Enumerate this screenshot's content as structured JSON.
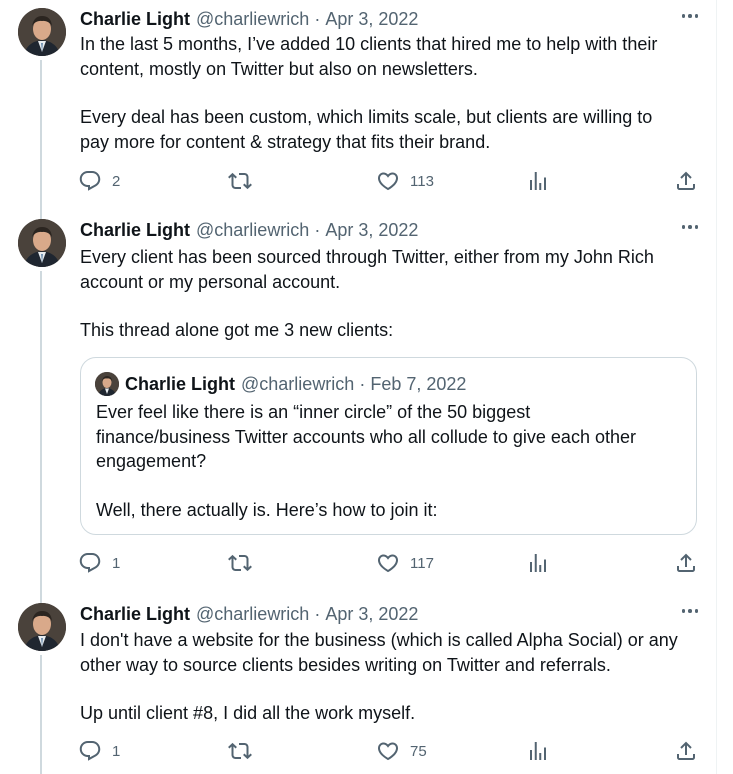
{
  "colors": {
    "text": "#0f1419",
    "secondary": "#536471",
    "line": "#cfd9de"
  },
  "tweets": [
    {
      "name": "Charlie Light",
      "handle": "@charliewrich",
      "dot": "·",
      "date": "Apr 3, 2022",
      "paragraphs": [
        "In the last 5 months, I’ve added 10 clients that hired me to help with their\ncontent, mostly on Twitter but also on newsletters.",
        "Every deal has been custom, which limits scale, but clients are willing to\npay more for content & strategy that fits their brand."
      ],
      "replies": "2",
      "retweets": "",
      "likes": "113"
    },
    {
      "name": "Charlie Light",
      "handle": "@charliewrich",
      "dot": "·",
      "date": "Apr 3, 2022",
      "paragraphs": [
        "Every client has been sourced through Twitter, either from my John Rich\naccount or my personal account.",
        "This thread alone got me 3 new clients:"
      ],
      "quote": {
        "name": "Charlie Light",
        "handle": "@charliewrich",
        "dot": "·",
        "date": "Feb 7, 2022",
        "paragraphs": [
          "Ever feel like there is an “inner circle” of the 50 biggest\nfinance/business Twitter accounts who all collude to give each other\nengagement?",
          "Well, there actually is. Here’s how to join it:"
        ]
      },
      "replies": "1",
      "retweets": "",
      "likes": "117"
    },
    {
      "name": "Charlie Light",
      "handle": "@charliewrich",
      "dot": "·",
      "date": "Apr 3, 2022",
      "paragraphs": [
        "I don't have a website for the business (which is called Alpha Social) or any\nother way to source clients besides writing on Twitter and referrals.",
        "Up until client #8, I did all the work myself."
      ],
      "replies": "1",
      "retweets": "",
      "likes": "75"
    }
  ],
  "icons": {
    "reply": "reply-icon",
    "retweet": "retweet-icon",
    "like": "heart-icon",
    "views": "views-icon",
    "share": "share-icon",
    "more": "more-icon"
  }
}
